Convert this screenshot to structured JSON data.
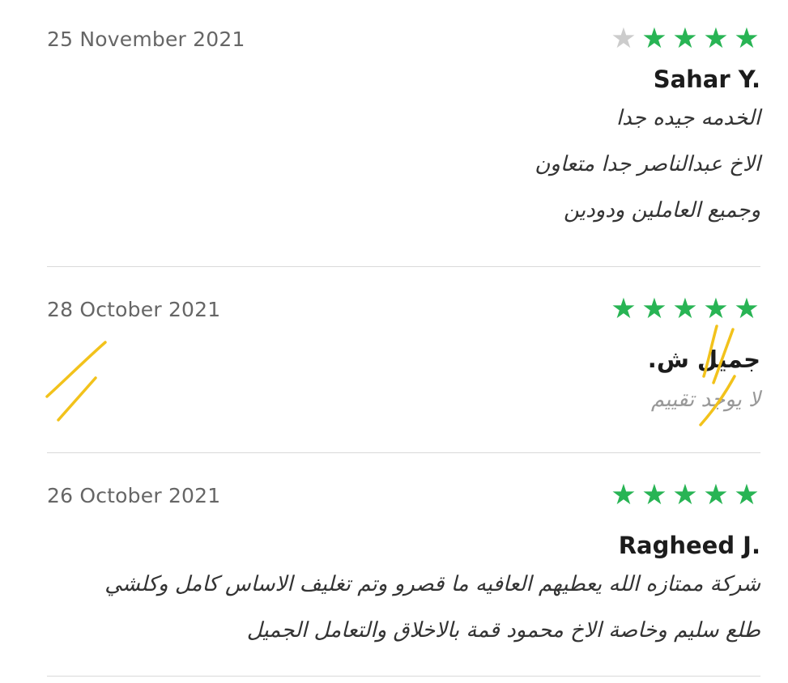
{
  "reviews": [
    {
      "date": "25 November 2021",
      "rating": 4,
      "max_rating": 5,
      "name": "Sahar Y.",
      "lines": [
        "الخدمه جيده جدا",
        "الاخ عبدالناصر جدا متعاون",
        "وجميع العاملين ودودين"
      ]
    },
    {
      "date": "28 October 2021",
      "rating": 5,
      "max_rating": 5,
      "name": "جميل ش.",
      "lines": [
        "لا يوجد تقييم"
      ]
    },
    {
      "date": "26 October 2021",
      "rating": 5,
      "max_rating": 5,
      "name": "Ragheed J.",
      "lines": [
        "شركة ممتازه الله يعطيهم العافيه ما قصرو وتم تغليف الاساس كامل وكلشي",
        "طلع سليم وخاصة الاخ محمود قمة بالاخلاق والتعامل الجميل"
      ]
    }
  ],
  "colors": {
    "star_filled": "#28b454",
    "star_empty": "#cccccc",
    "annotation": "#f2c21b"
  },
  "icons": {
    "star": "star-icon"
  }
}
